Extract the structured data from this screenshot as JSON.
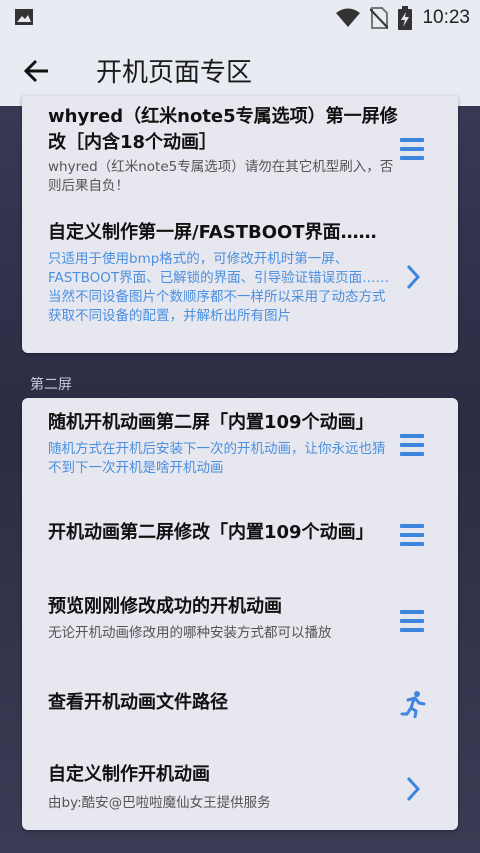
{
  "status": {
    "time": "10:23",
    "icons": [
      "image-icon",
      "wifi-icon",
      "no-sim-icon",
      "battery-charging-icon"
    ]
  },
  "appbar": {
    "title": "开机页面专区",
    "back_icon": "arrow-left-icon"
  },
  "cards": {
    "first": {
      "items": [
        {
          "title": "whyred（红米note5专属选项）第一屏修改［内含18个动画］",
          "desc": "whyred（红米note5专属选项）请勿在其它机型刷入，否则后果自负！",
          "icon": "menu-icon"
        },
        {
          "title": "自定义制作第一屏/FASTBOOT界面……",
          "desc": "只适用于使用bmp格式的，可修改开机时第一屏、FASTBOOT界面、已解锁的界面、引导验证错误页面……\n当然不同设备图片个数顺序都不一样所以采用了动态方式获取不同设备的配置，并解析出所有图片",
          "icon": "chevron-right-icon"
        }
      ]
    },
    "section_label": "第二屏",
    "second": {
      "items": [
        {
          "title": "随机开机动画第二屏「内置109个动画」",
          "desc": "随机方式在开机后安装下一次的开机动画，让你永远也猜不到下一次开机是啥开机动画",
          "icon": "menu-icon"
        },
        {
          "title": "开机动画第二屏修改「内置109个动画」",
          "desc": "",
          "icon": "menu-icon"
        },
        {
          "title": "预览刚刚修改成功的开机动画",
          "desc": "无论开机动画修改用的哪种安装方式都可以播放",
          "icon": "menu-icon"
        },
        {
          "title": "查看开机动画文件路径",
          "desc": "",
          "icon": "running-person-icon"
        },
        {
          "title": "自定义制作开机动画",
          "desc": "由by:酷安@巴啦啦魔仙女王提供服务",
          "icon": "chevron-right-icon"
        }
      ]
    }
  },
  "colors": {
    "accent": "#3d86e0",
    "blue_desc": "#4a8fe0",
    "card_bg": "#e7e8ef",
    "page_bg": "#2f3149"
  }
}
